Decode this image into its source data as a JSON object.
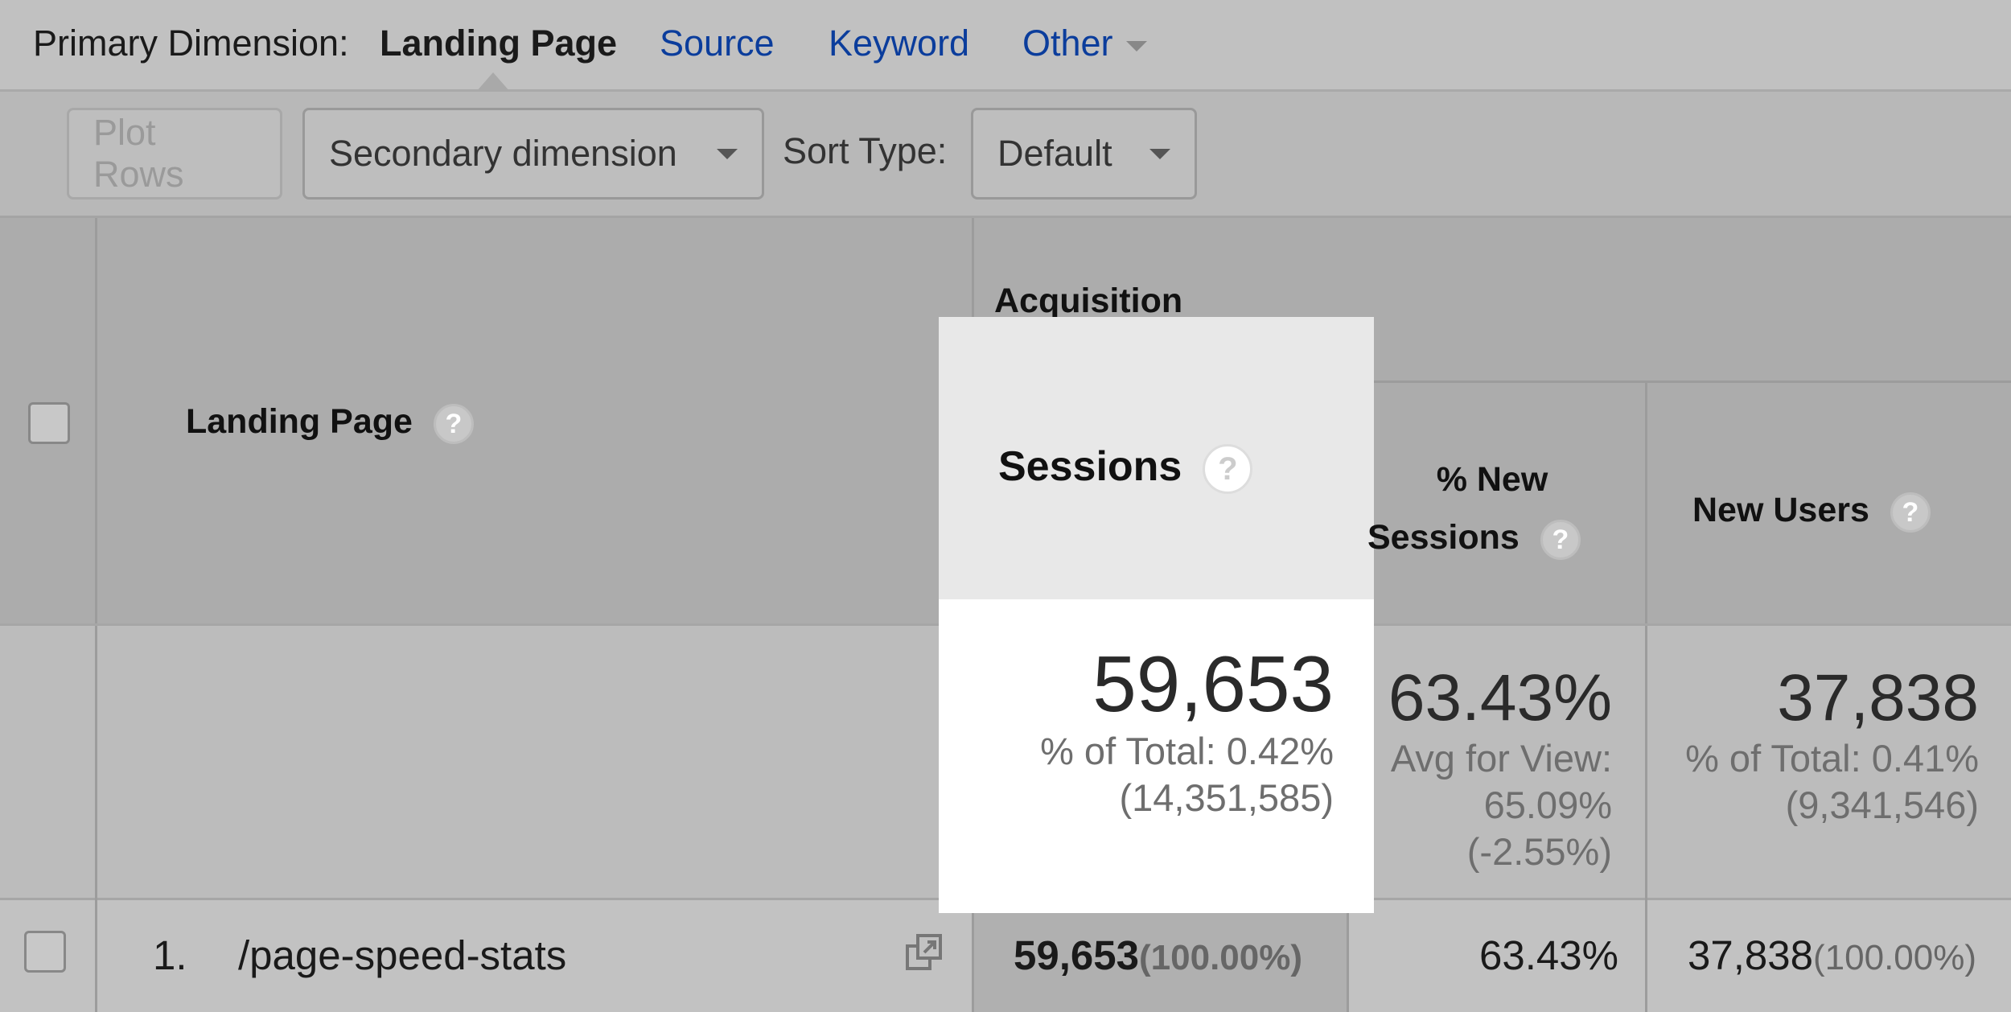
{
  "primary_dimension": {
    "label": "Primary Dimension:",
    "active": "Landing Page",
    "options": [
      "Source",
      "Keyword",
      "Other"
    ]
  },
  "toolbar": {
    "plot_rows": "Plot Rows",
    "secondary_dimension": "Secondary dimension",
    "sort_type_label": "Sort Type:",
    "sort_type_value": "Default"
  },
  "table": {
    "group_header": "Acquisition",
    "columns": {
      "landing_page": "Landing Page",
      "sessions": "Sessions",
      "pct_new_sessions_line1": "% New",
      "pct_new_sessions_line2": "Sessions",
      "new_users": "New Users"
    },
    "help_icon": "?",
    "summary": {
      "sessions": {
        "value": "59,653",
        "line1": "% of Total: 0.42%",
        "line2": "(14,351,585)"
      },
      "pct_new_sessions": {
        "value": "63.43%",
        "line1": "Avg for View:",
        "line2": "65.09%",
        "line3": "(-2.55%)"
      },
      "new_users": {
        "value": "37,838",
        "line1": "% of Total: 0.41%",
        "line2": "(9,341,546)"
      }
    },
    "rows": [
      {
        "index": "1.",
        "landing_page": "/page-speed-stats",
        "sessions": "59,653",
        "sessions_pct": "(100.00%)",
        "pct_new_sessions": "63.43%",
        "new_users": "37,838",
        "new_users_pct": "(100.00%)"
      }
    ]
  }
}
